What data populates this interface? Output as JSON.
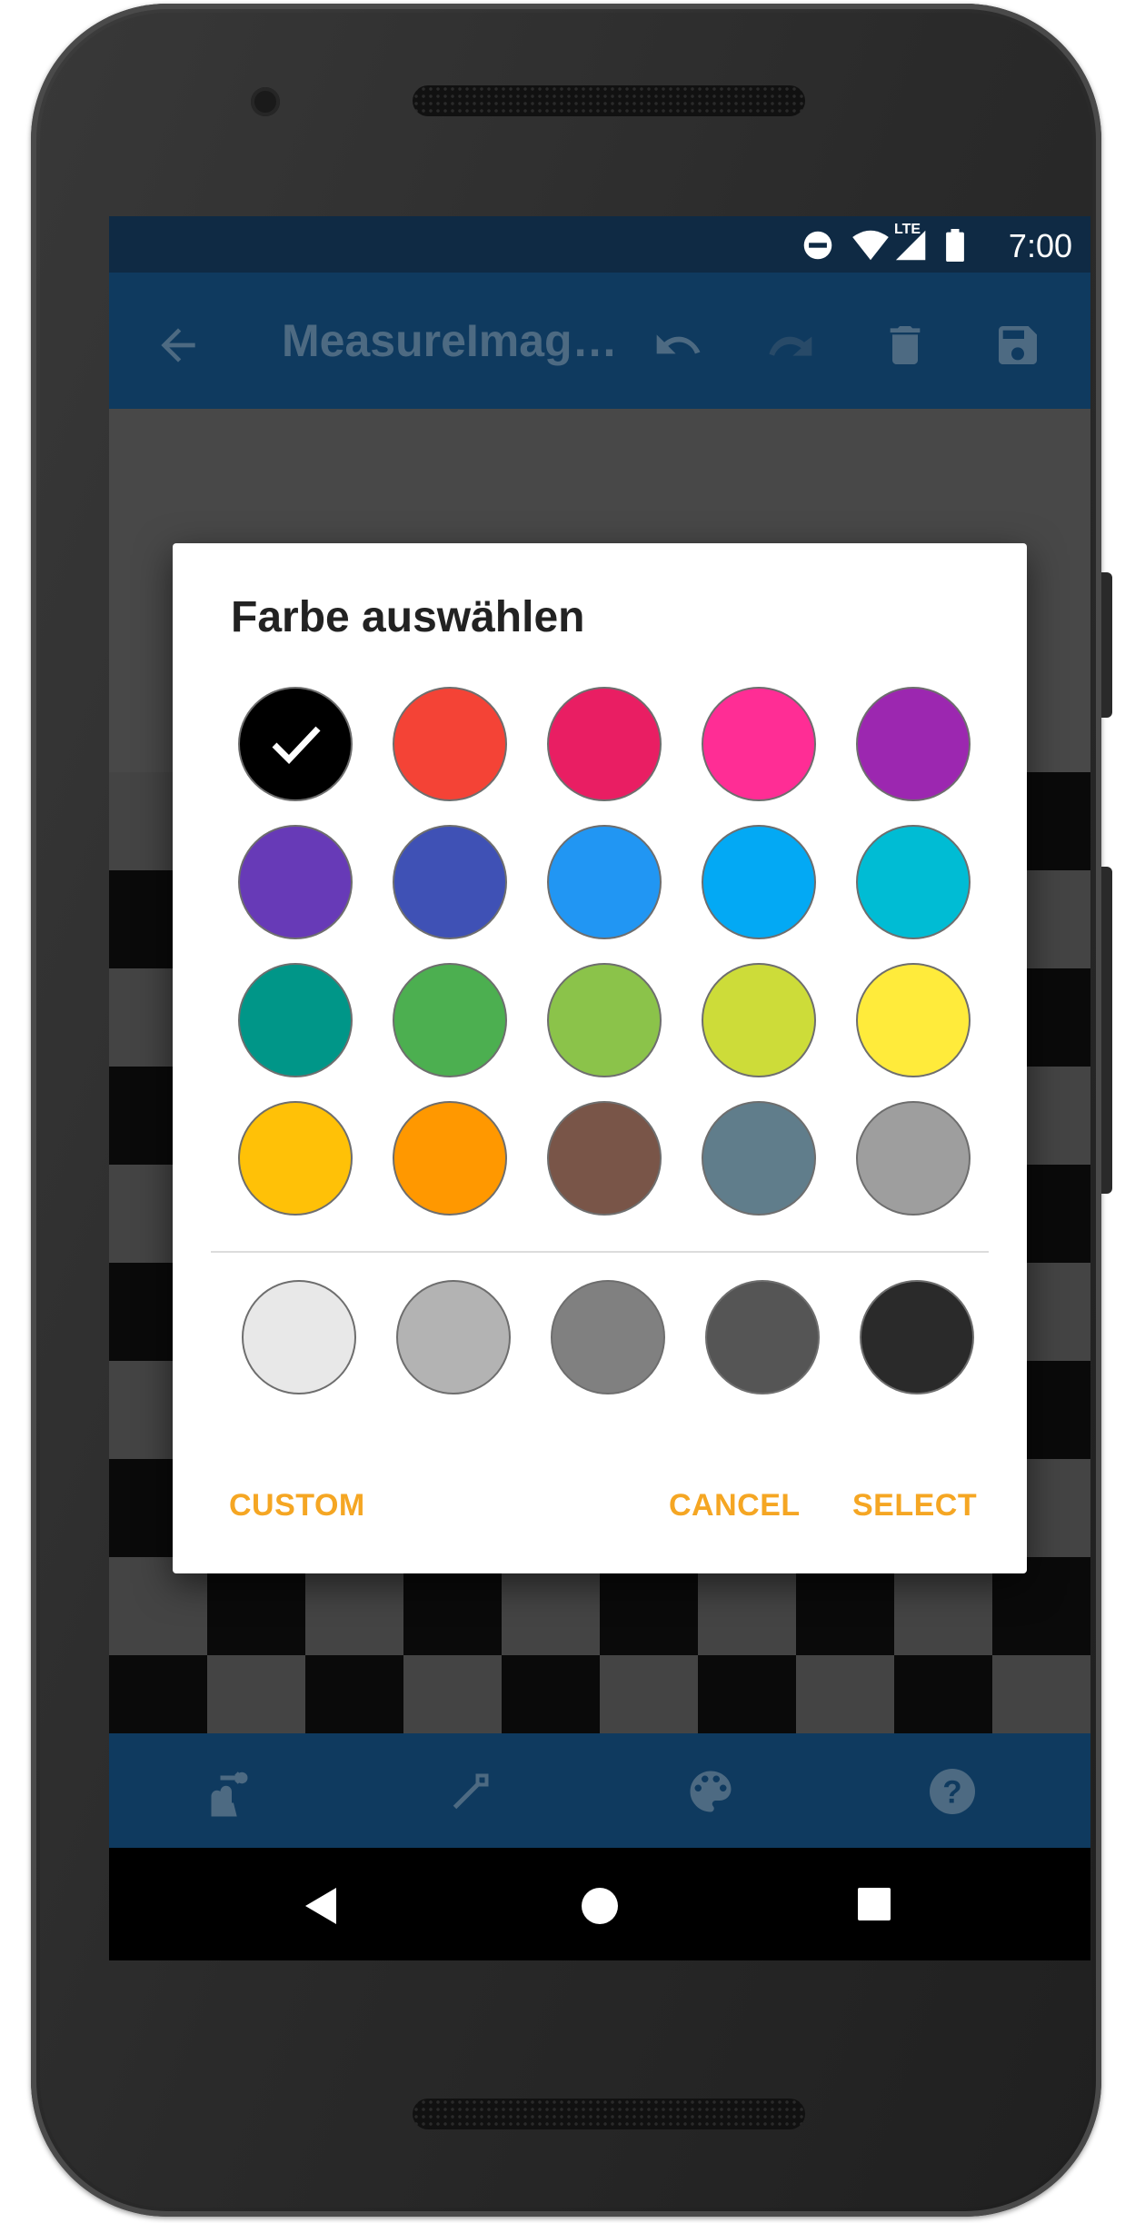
{
  "status_bar": {
    "time": "7:00",
    "network": "LTE"
  },
  "app_bar": {
    "title": "MeasureImag…"
  },
  "dialog": {
    "title": "Farbe auswählen",
    "selected_index": 0,
    "primary_colors": [
      "#000000",
      "#f44336",
      "#e91e63",
      "#ff2d95",
      "#9c27b0",
      "#673ab7",
      "#3f51b5",
      "#2196f3",
      "#03a9f4",
      "#00bcd4",
      "#009688",
      "#4caf50",
      "#8bc34a",
      "#cddc39",
      "#ffeb3b",
      "#ffc107",
      "#ff9800",
      "#795548",
      "#607d8b",
      "#9e9e9e"
    ],
    "gray_colors": [
      "#e8e8e8",
      "#b3b3b3",
      "#808080",
      "#555555",
      "#2a2a2a"
    ],
    "buttons": {
      "custom": "CUSTOM",
      "cancel": "CANCEL",
      "select": "SELECT"
    },
    "accent": "#f5a623"
  },
  "bottom_nav": {
    "icons": [
      "measure-gesture-icon",
      "line-tool-icon",
      "palette-icon",
      "help-icon"
    ]
  },
  "system_nav": {
    "icons": [
      "back-icon",
      "home-icon",
      "recents-icon"
    ]
  }
}
